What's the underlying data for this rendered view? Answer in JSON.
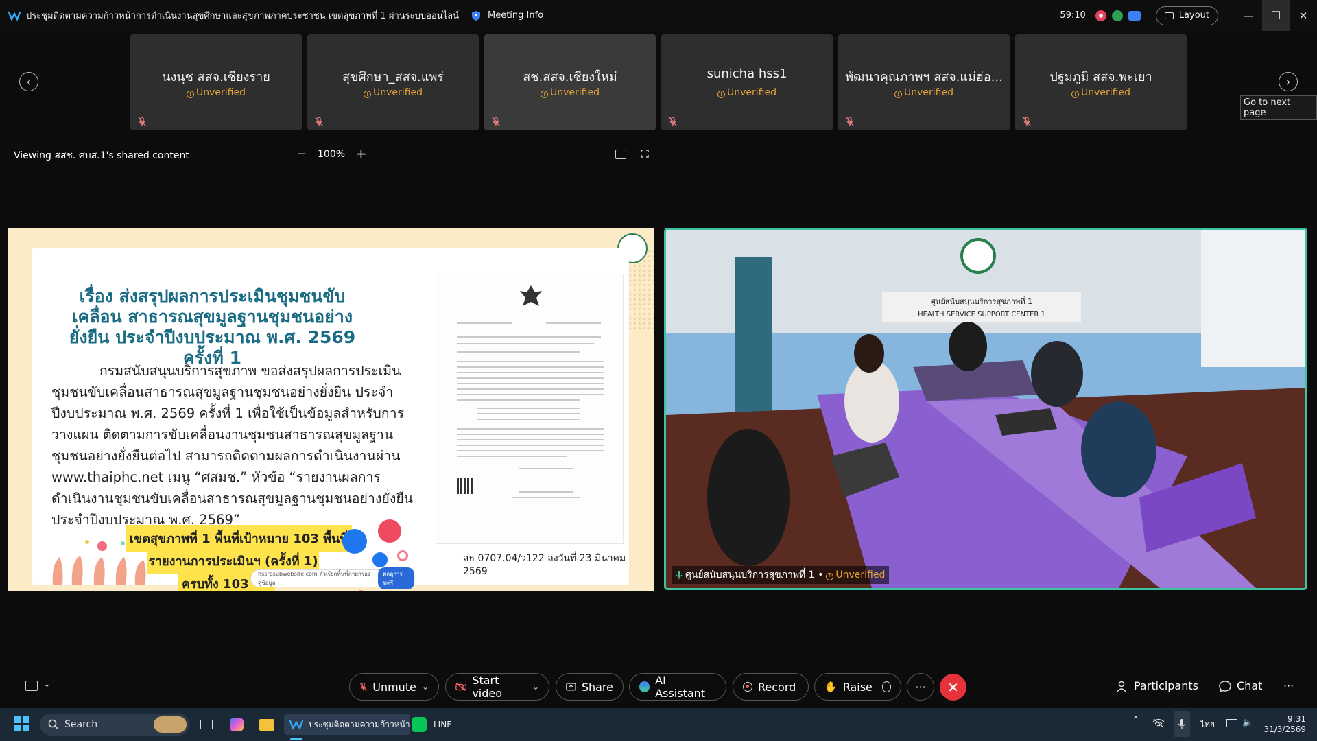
{
  "titlebar": {
    "meeting_title": "ประชุมติดตามความก้าวหน้าการดำเนินงานสุขศึกษาและสุขภาพภาคประชาชน เขตสุขภาพที่ 1 ผ่านระบบออนไลน์",
    "meeting_info": "Meeting Info",
    "timer": "59:10",
    "layout": "Layout"
  },
  "participants": [
    {
      "name": "นงนุช สสจ.เชียงราย",
      "status": "Unverified"
    },
    {
      "name": "สุขศึกษา_สสจ.แพร่",
      "status": "Unverified"
    },
    {
      "name": "สช.สสจ.เชียงใหม่",
      "status": "Unverified"
    },
    {
      "name": "sunicha hss1",
      "status": "Unverified"
    },
    {
      "name": "พัฒนาคุณภาพฯ สสจ.แม่ฮ่อ...",
      "status": "Unverified"
    },
    {
      "name": "ปฐมภูมิ สสจ.พะเยา",
      "status": "Unverified"
    }
  ],
  "tooltip": "Go to next page",
  "viewing": {
    "label": "Viewing สสช. ศบส.1's shared content",
    "zoom": "100%"
  },
  "slide": {
    "title": "เรื่อง ส่งสรุปผลการประเมินชุมชนขับเคลื่อน สาธารณสุขมูลฐานชุมชนอย่างยั่งยืน ประจำปีงบประมาณ พ.ศ. 2569 ครั้งที่ 1",
    "body": "กรมสนับสนุนบริการสุขภาพ ขอส่งสรุปผลการประเมินชุมชนขับเคลื่อนสาธารณสุขมูลฐานชุมชนอย่างยั่งยืน ประจำปีงบประมาณ พ.ศ. 2569 ครั้งที่ 1 เพื่อใช้เป็นข้อมูลสำหรับการวางแผน ติดตามการขับเคลื่อนงานชุมชนสาธารณสุขมูลฐานชุมชนอย่างยั่งยืนต่อไป สามารถติดตามผลการดำเนินงานผ่าน www.thaiphc.net เมนู “ศสมช.” หัวข้อ “รายงานผลการดำเนินงานชุมชนขับเคลื่อนสาธารณสุขมูลฐานชุมชนอย่างยั่งยืน ประจำปีงบประมาณ พ.ศ. 2569”",
    "box1": "เขตสุขภาพที่ 1 พื้นที่เป้าหมาย  103 พื้นที่",
    "box2": "รายงานการประเมินฯ (ครั้งที่ 1)",
    "box3": "ครบทั้ง 103",
    "url_text": "hssrpsubwebsite.com ตัวเรียกพื้นที่ภายกรองดูข้อมูล",
    "url_button": "ผลดูการทดรี",
    "doc_caption": "สธ 0707.04/ว122  ลงวันที่ 23 มีนาคม 2569"
  },
  "camera": {
    "name": "ศูนย์สนับสนุนบริการสุขภาพที่ 1 •",
    "status": "Unverified",
    "sign_line1": "ศูนย์สนับสนุนบริการสุขภาพที่ 1",
    "sign_line2": "HEALTH SERVICE SUPPORT CENTER 1"
  },
  "controls": {
    "unmute": "Unmute",
    "start_video": "Start video",
    "share": "Share",
    "ai_assistant": "AI Assistant",
    "record": "Record",
    "raise": "Raise",
    "more": "···",
    "participants": "Participants",
    "chat": "Chat",
    "overflow": "···"
  },
  "taskbar": {
    "search": "Search",
    "webex_app": "ประชุมติดตามความก้าวหน้า",
    "line_app": "LINE",
    "language": "ไทย",
    "time": "9:31",
    "date": "31/3/2569"
  },
  "colors": {
    "accent_teal": "#3fc2a1",
    "unverified": "#e3a33a",
    "end_call": "#e5323b",
    "slide_title": "#1a6b84",
    "highlight": "#ffe34d"
  }
}
